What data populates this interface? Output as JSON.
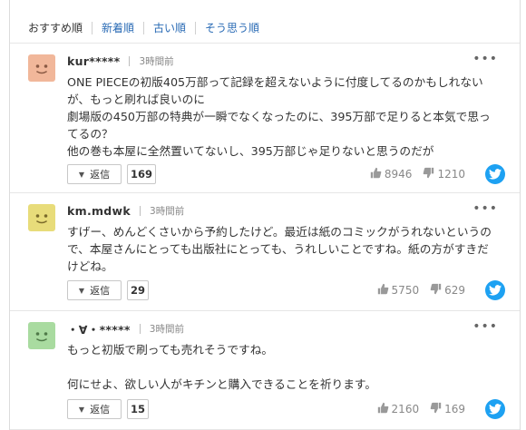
{
  "sort_tabs": [
    {
      "label": "おすすめ順",
      "active": true
    },
    {
      "label": "新着順",
      "active": false
    },
    {
      "label": "古い順",
      "active": false
    },
    {
      "label": "そう思う順",
      "active": false
    }
  ],
  "comments": [
    {
      "user": "kur*****",
      "time": "3時間前",
      "avatar_color": "#f1b79a",
      "text": "ONE PIECEの初版405万部って記録を超えないように付度してるのかもしれないが、もっと刷れば良いのに\n劇場版の450万部の特典が一瞬でなくなったのに、395万部で足りると本気で思ってるの？\n他の巻も本屋に全然置いてないし、395万部じゃ足りないと思うのだが",
      "reply_label": "返信",
      "reply_count": "169",
      "agree": "8946",
      "disagree": "1210"
    },
    {
      "user": "km.mdwk",
      "time": "3時間前",
      "avatar_color": "#e8dc7a",
      "text": "すげー、めんどくさいから予約したけど。最近は紙のコミックがうれないというので、本屋さんにとっても出版社にとっても、うれしいことですね。紙の方がすきだけどね。",
      "reply_label": "返信",
      "reply_count": "29",
      "agree": "5750",
      "disagree": "629"
    },
    {
      "user": "・∀・*****",
      "time": "3時間前",
      "avatar_color": "#a9dba0",
      "text": "もっと初版で刷っても売れそうですね。\n\n何にせよ、欲しい人がキチンと購入できることを祈ります。",
      "reply_label": "返信",
      "reply_count": "15",
      "agree": "2160",
      "disagree": "169"
    }
  ],
  "icons": {
    "more": "more-icon",
    "agree": "thumbs-up-icon",
    "disagree": "thumbs-down-icon",
    "share": "twitter-icon"
  },
  "colors": {
    "link": "#2a6bb5",
    "twitter": "#1da1f2"
  }
}
